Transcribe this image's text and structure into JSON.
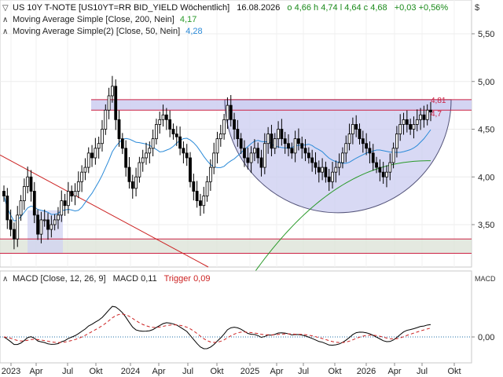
{
  "header": {
    "instrument": "US 10Y T-NOTE [US10YT=RR BID_YIELD Wöchentlich]",
    "date": "16.08.2026",
    "ohlc": "o 4,66  h 4,74  l 4,64  c 4,68",
    "change": "+0,03  +0,56%"
  },
  "indicators": [
    {
      "label": "Moving Average Simple  [Close, 200, Nein]",
      "value": "4,17",
      "color": "#2a9a2a"
    },
    {
      "label": "Moving Average Simple(2)  [Close, 50, Nein]",
      "value": "4,28",
      "color": "#2a8ad8"
    }
  ],
  "macd_header": {
    "label": "MACD  [Close, 12, 26, 9]",
    "macd_text": "MACD 0,11",
    "trigger_text": "Trigger 0,09",
    "panel_label": "MACD"
  },
  "top_right_label": "$",
  "price_labels": {
    "a": "4,81",
    "b": "4,7"
  },
  "colors": {
    "up_candle": "#ffffff",
    "down_candle": "#000000",
    "ma200": "#2a9a2a",
    "ma50": "#2a8ad8",
    "resistance": "#cc2244",
    "trendline": "#cc2222",
    "channel_fill": "#dde3d8",
    "zone_fill": "#cfd0f2",
    "macd_line": "#000000",
    "trigger_line": "#cc2222",
    "zero_line": "#1e6fa8"
  },
  "chart_data": [
    {
      "type": "candlestick",
      "title": "US 10Y T-NOTE weekly yield",
      "ylim": [
        3.0,
        5.7
      ],
      "y_ticks": [
        "5,50",
        "5,00",
        "4,50",
        "4,00",
        "3,50"
      ],
      "x_ticks": [
        "2023",
        "Apr",
        "Jul",
        "Okt",
        "2024",
        "Apr",
        "Jul",
        "Okt",
        "2025",
        "Apr",
        "Jul",
        "Okt",
        "2026",
        "Apr",
        "Jul",
        "Okt"
      ],
      "close_series": [
        3.8,
        3.55,
        3.45,
        3.35,
        3.6,
        3.75,
        3.9,
        4.0,
        3.85,
        3.6,
        3.4,
        3.55,
        3.55,
        3.45,
        3.5,
        3.55,
        3.6,
        3.75,
        3.7,
        3.85,
        3.8,
        3.85,
        3.95,
        4.05,
        4.1,
        4.25,
        4.2,
        4.3,
        4.35,
        4.5,
        4.7,
        4.85,
        4.95,
        4.6,
        4.4,
        4.3,
        4.1,
        3.95,
        3.88,
        4.0,
        4.15,
        4.2,
        4.25,
        4.3,
        4.4,
        4.55,
        4.6,
        4.65,
        4.6,
        4.5,
        4.45,
        4.42,
        4.3,
        4.25,
        4.2,
        3.95,
        3.85,
        3.75,
        3.7,
        3.8,
        3.95,
        4.1,
        4.25,
        4.4,
        4.45,
        4.6,
        4.75,
        4.6,
        4.5,
        4.4,
        4.3,
        4.2,
        4.15,
        4.25,
        4.3,
        4.2,
        4.1,
        4.35,
        4.45,
        4.3,
        4.4,
        4.5,
        4.4,
        4.35,
        4.3,
        4.25,
        4.4,
        4.35,
        4.3,
        4.25,
        4.2,
        4.15,
        4.1,
        4.05,
        4.1,
        4.0,
        3.95,
        4.05,
        4.1,
        4.15,
        4.25,
        4.35,
        4.45,
        4.55,
        4.5,
        4.4,
        4.35,
        4.3,
        4.25,
        4.15,
        4.1,
        4.05,
        4.0,
        4.05,
        4.15,
        4.3,
        4.45,
        4.55,
        4.6,
        4.55,
        4.5,
        4.55,
        4.6,
        4.65,
        4.6,
        4.7,
        4.68
      ],
      "series": [
        {
          "name": "Moving Average Simple [Close, 200, Nein]",
          "last": 4.17
        },
        {
          "name": "Moving Average Simple(2) [Close, 50, Nein]",
          "last": 4.28
        }
      ],
      "horizontal_levels": [
        4.81,
        4.7,
        3.35,
        3.2
      ],
      "annotations": [
        "4,81",
        "4,7"
      ]
    },
    {
      "type": "line",
      "title": "MACD [Close, 12, 26, 9]",
      "ylim": [
        -0.4,
        0.55
      ],
      "y_ticks": [
        "0,00"
      ],
      "series": [
        {
          "name": "MACD",
          "last": 0.11
        },
        {
          "name": "Trigger",
          "last": 0.09
        }
      ]
    }
  ]
}
